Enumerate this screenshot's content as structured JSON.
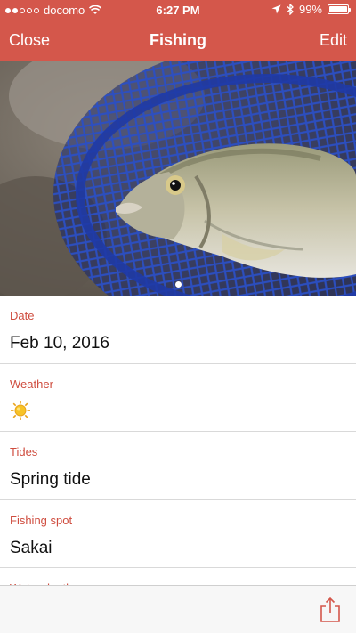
{
  "status_bar": {
    "carrier": "docomo",
    "time": "6:27 PM",
    "battery": "99%",
    "battery_level": 0.99,
    "signal_bars_filled": 2,
    "signal_bars_total": 5,
    "icons": [
      "wifi-icon",
      "location-arrow-icon",
      "bluetooth-icon",
      "battery-icon"
    ]
  },
  "nav": {
    "left_label": "Close",
    "title": "Fishing",
    "right_label": "Edit"
  },
  "photo": {
    "page_indicator": {
      "current": 1,
      "total": 1
    }
  },
  "details": [
    {
      "label": "Date",
      "value": "Feb 10, 2016"
    },
    {
      "label": "Weather",
      "icon": "sun-icon"
    },
    {
      "label": "Tides",
      "value": "Spring tide"
    },
    {
      "label": "Fishing spot",
      "value": "Sakai"
    },
    {
      "label": "Water depth"
    }
  ],
  "toolbar": {
    "share_icon": "share-icon"
  },
  "colors": {
    "accent": "#d4574b",
    "label": "#cf4d3f",
    "toolbar_bg": "#f7f7f7"
  }
}
